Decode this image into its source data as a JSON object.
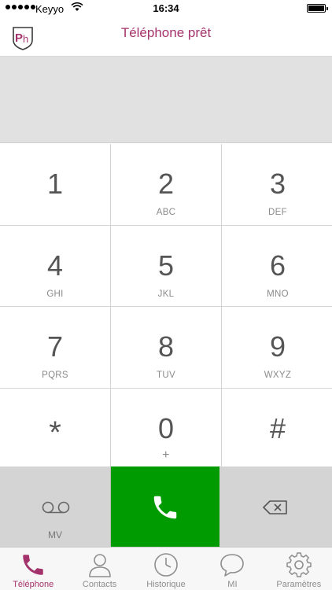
{
  "status_bar": {
    "carrier": "Keyyo",
    "time": "16:34"
  },
  "header": {
    "logo_text": "Ph",
    "title": "Téléphone prêt"
  },
  "display": {
    "number": ""
  },
  "keypad": {
    "keys": [
      {
        "digit": "1",
        "letters": ""
      },
      {
        "digit": "2",
        "letters": "ABC"
      },
      {
        "digit": "3",
        "letters": "DEF"
      },
      {
        "digit": "4",
        "letters": "GHI"
      },
      {
        "digit": "5",
        "letters": "JKL"
      },
      {
        "digit": "6",
        "letters": "MNO"
      },
      {
        "digit": "7",
        "letters": "PQRS"
      },
      {
        "digit": "8",
        "letters": "TUV"
      },
      {
        "digit": "9",
        "letters": "WXYZ"
      },
      {
        "digit": "*",
        "letters": ""
      },
      {
        "digit": "0",
        "letters": "+"
      },
      {
        "digit": "#",
        "letters": ""
      }
    ]
  },
  "actions": {
    "voicemail_label": "MV",
    "call_icon": "phone-icon",
    "backspace_icon": "backspace-icon"
  },
  "tabbar": {
    "tabs": [
      {
        "label": "Téléphone",
        "icon": "phone-icon",
        "active": true
      },
      {
        "label": "Contacts",
        "icon": "contact-icon",
        "active": false
      },
      {
        "label": "Historique",
        "icon": "clock-icon",
        "active": false
      },
      {
        "label": "MI",
        "icon": "chat-bubble-icon",
        "active": false
      },
      {
        "label": "Paramètres",
        "icon": "gear-icon",
        "active": false
      }
    ]
  },
  "colors": {
    "accent": "#a5336b",
    "call_green": "#009b00",
    "key_gray": "#d4d4d4"
  }
}
